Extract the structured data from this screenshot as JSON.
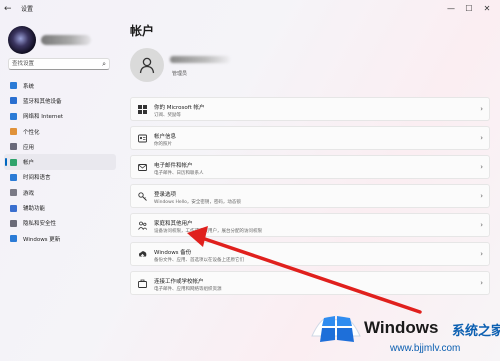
{
  "window": {
    "app_title": "设置",
    "controls": [
      "—",
      "☐",
      "✕"
    ]
  },
  "sidebar": {
    "search_placeholder": "查找设置",
    "items": [
      {
        "label": "系统",
        "icon": "system-icon",
        "color": "#2b7bd6"
      },
      {
        "label": "蓝牙和其他设备",
        "icon": "bluetooth-icon",
        "color": "#2a6fd0"
      },
      {
        "label": "网络和 Internet",
        "icon": "network-icon",
        "color": "#2b7bd6"
      },
      {
        "label": "个性化",
        "icon": "brush-icon",
        "color": "#e0923a"
      },
      {
        "label": "应用",
        "icon": "apps-icon",
        "color": "#6a6a7a"
      },
      {
        "label": "帐户",
        "icon": "account-icon",
        "color": "#2fa36b",
        "active": true
      },
      {
        "label": "时间和语言",
        "icon": "time-language-icon",
        "color": "#2b7bd6"
      },
      {
        "label": "游戏",
        "icon": "game-icon",
        "color": "#7a7a86"
      },
      {
        "label": "辅助功能",
        "icon": "accessibility-icon",
        "color": "#3a6fcf"
      },
      {
        "label": "隐私和安全性",
        "icon": "shield-icon",
        "color": "#6b6b78"
      },
      {
        "label": "Windows 更新",
        "icon": "update-icon",
        "color": "#2b7bd6"
      }
    ]
  },
  "main": {
    "page_title": "帐户",
    "account_role": "管理员",
    "cards": [
      {
        "title": "你的 Microsoft 帐户",
        "subtitle": "订阅、奖励等",
        "icon": "microsoft-icon"
      },
      {
        "title": "帐户信息",
        "subtitle": "你的照片",
        "icon": "person-card-icon"
      },
      {
        "title": "电子邮件和帐户",
        "subtitle": "电子邮件、日历和联系人",
        "icon": "mail-icon"
      },
      {
        "title": "登录选项",
        "subtitle": "Windows Hello，安全密钥，密码，动态锁",
        "icon": "key-icon"
      },
      {
        "title": "家庭和其他用户",
        "subtitle": "设备访问权限，工作或学校用户，展台分配的访问权限",
        "icon": "family-icon"
      },
      {
        "title": "Windows 备份",
        "subtitle": "备份文件、应用、首选项以在设备上还原它们",
        "icon": "backup-icon"
      },
      {
        "title": "连接工作或学校帐户",
        "subtitle": "电子邮件、应用和网络等组织资源",
        "icon": "briefcase-icon"
      }
    ],
    "chevron": "›"
  },
  "watermark": {
    "title": "Windows",
    "cn": "系统之家",
    "url": "www.bjjmlv.com"
  },
  "accent": "#0067c0",
  "annotation_color": "#e0201d"
}
